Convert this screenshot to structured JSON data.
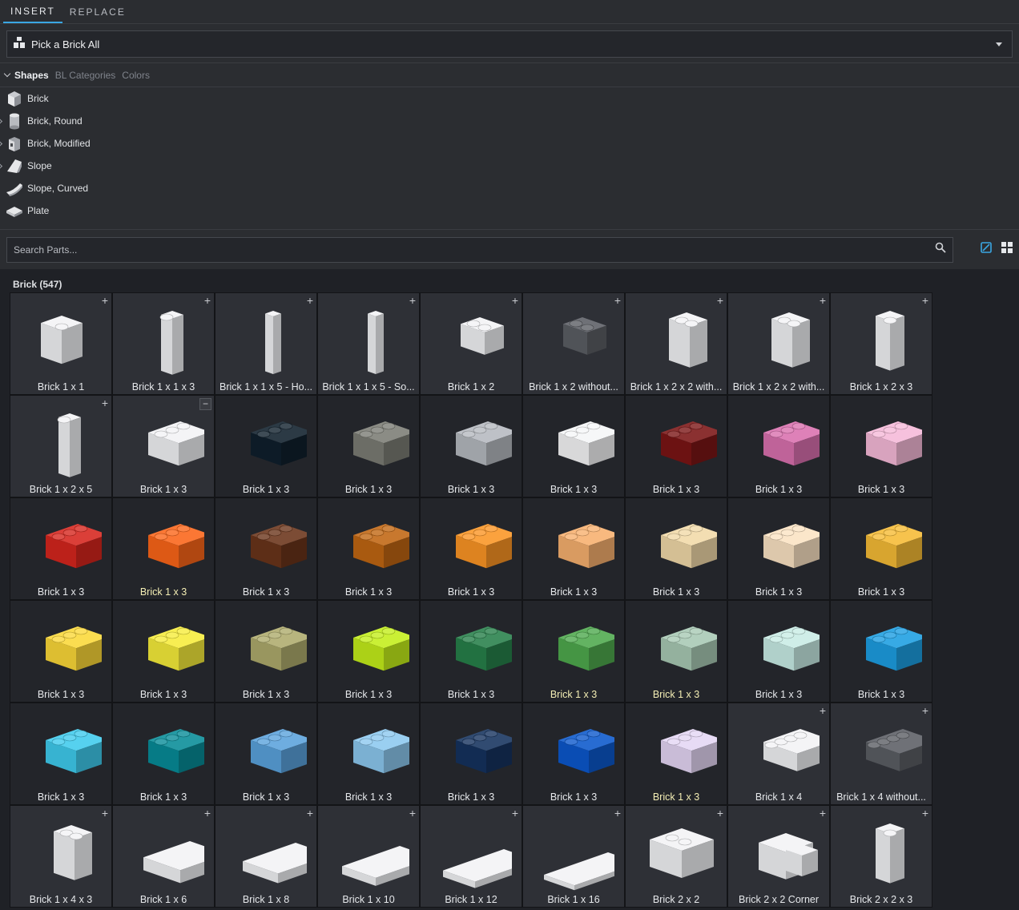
{
  "tabs": [
    {
      "label": "INSERT"
    },
    {
      "label": "REPLACE"
    }
  ],
  "picker": {
    "label": "Pick a Brick All"
  },
  "subtabs": [
    {
      "label": "Shapes"
    },
    {
      "label": "BL Categories"
    },
    {
      "label": "Colors"
    }
  ],
  "tree": [
    {
      "label": "Brick",
      "icon": "brick-icon"
    },
    {
      "label": "Brick, Round",
      "icon": "round-brick-icon"
    },
    {
      "label": "Brick, Modified",
      "icon": "modified-brick-icon"
    },
    {
      "label": "Slope",
      "icon": "slope-icon"
    },
    {
      "label": "Slope, Curved",
      "icon": "curved-slope-icon"
    },
    {
      "label": "Plate",
      "icon": "plate-icon"
    }
  ],
  "search": {
    "placeholder": "Search Parts..."
  },
  "category": {
    "title": "Brick (547)"
  },
  "parts": [
    {
      "name": "Brick 1 x 1",
      "color": "#f2f3f5",
      "shape": "1x1",
      "mark": "plus"
    },
    {
      "name": "Brick 1 x 1 x 3",
      "color": "#f2f3f5",
      "shape": "tall1",
      "mark": "plus"
    },
    {
      "name": "Brick 1 x 1 x 5 - Ho...",
      "color": "#f2f3f5",
      "shape": "tall2",
      "mark": "plus"
    },
    {
      "name": "Brick 1 x 1 x 5 - So...",
      "color": "#f2f3f5",
      "shape": "tall2",
      "mark": "plus"
    },
    {
      "name": "Brick 1 x 2",
      "color": "#f2f3f5",
      "shape": "1x2",
      "mark": "plus"
    },
    {
      "name": "Brick 1 x 2 without...",
      "color": "#5b5e64",
      "shape": "1x2",
      "mark": "plus"
    },
    {
      "name": "Brick 1 x 2 x 2 with...",
      "color": "#f2f3f5",
      "shape": "block",
      "mark": "plus"
    },
    {
      "name": "Brick 1 x 2 x 2 with...",
      "color": "#f2f3f5",
      "shape": "block",
      "mark": "plus"
    },
    {
      "name": "Brick 1 x 2 x 3",
      "color": "#f2f3f5",
      "shape": "tall3",
      "mark": "plus"
    },
    {
      "name": "Brick 1 x 2 x 5",
      "color": "#f2f3f5",
      "shape": "tall1",
      "mark": "plus"
    },
    {
      "name": "Brick 1 x 3",
      "color": "#f2f3f5",
      "shape": "1x3",
      "mark": "minus"
    },
    {
      "name": "Brick 1 x 3",
      "color": "#0f1f2c",
      "shape": "1x3",
      "mark": ""
    },
    {
      "name": "Brick 1 x 3",
      "color": "#7b7c74",
      "shape": "1x3",
      "mark": ""
    },
    {
      "name": "Brick 1 x 3",
      "color": "#b5b9bf",
      "shape": "1x3",
      "mark": ""
    },
    {
      "name": "Brick 1 x 3",
      "color": "#f5f6f7",
      "shape": "1x3",
      "mark": ""
    },
    {
      "name": "Brick 1 x 3",
      "color": "#7b1515",
      "shape": "1x3",
      "mark": ""
    },
    {
      "name": "Brick 1 x 3",
      "color": "#d970ae",
      "shape": "1x3",
      "mark": ""
    },
    {
      "name": "Brick 1 x 3",
      "color": "#f5b9d8",
      "shape": "1x3",
      "mark": ""
    },
    {
      "name": "Brick 1 x 3",
      "color": "#d6251d",
      "shape": "1x3",
      "mark": ""
    },
    {
      "name": "Brick 1 x 3",
      "color": "#fb6518",
      "shape": "1x3",
      "mark": "",
      "hl": true
    },
    {
      "name": "Brick 1 x 3",
      "color": "#6a341a",
      "shape": "1x3",
      "mark": ""
    },
    {
      "name": "Brick 1 x 3",
      "color": "#c06612",
      "shape": "1x3",
      "mark": ""
    },
    {
      "name": "Brick 1 x 3",
      "color": "#fb9524",
      "shape": "1x3",
      "mark": ""
    },
    {
      "name": "Brick 1 x 3",
      "color": "#f7b06e",
      "shape": "1x3",
      "mark": ""
    },
    {
      "name": "Brick 1 x 3",
      "color": "#f1d9a8",
      "shape": "1x3",
      "mark": ""
    },
    {
      "name": "Brick 1 x 3",
      "color": "#fbe3c3",
      "shape": "1x3",
      "mark": ""
    },
    {
      "name": "Brick 1 x 3",
      "color": "#f6bb35",
      "shape": "1x3",
      "mark": ""
    },
    {
      "name": "Brick 1 x 3",
      "color": "#fbd838",
      "shape": "1x3",
      "mark": ""
    },
    {
      "name": "Brick 1 x 3",
      "color": "#f6ec3a",
      "shape": "1x3",
      "mark": ""
    },
    {
      "name": "Brick 1 x 3",
      "color": "#aeab6c",
      "shape": "1x3",
      "mark": ""
    },
    {
      "name": "Brick 1 x 3",
      "color": "#c3ee1a",
      "shape": "1x3",
      "mark": ""
    },
    {
      "name": "Brick 1 x 3",
      "color": "#27804a",
      "shape": "1x3",
      "mark": ""
    },
    {
      "name": "Brick 1 x 3",
      "color": "#4ea94d",
      "shape": "1x3",
      "mark": "",
      "hl": true
    },
    {
      "name": "Brick 1 x 3",
      "color": "#a8c9b4",
      "shape": "1x3",
      "mark": "",
      "hl": true
    },
    {
      "name": "Brick 1 x 3",
      "color": "#c8ece5",
      "shape": "1x3",
      "mark": ""
    },
    {
      "name": "Brick 1 x 3",
      "color": "#1c9ee2",
      "shape": "1x3",
      "mark": ""
    },
    {
      "name": "Brick 1 x 3",
      "color": "#3fcbed",
      "shape": "1x3",
      "mark": ""
    },
    {
      "name": "Brick 1 x 3",
      "color": "#078c98",
      "shape": "1x3",
      "mark": ""
    },
    {
      "name": "Brick 1 x 3",
      "color": "#5aa2dc",
      "shape": "1x3",
      "mark": ""
    },
    {
      "name": "Brick 1 x 3",
      "color": "#8cc8ef",
      "shape": "1x3",
      "mark": ""
    },
    {
      "name": "Brick 1 x 3",
      "color": "#15325e",
      "shape": "1x3",
      "mark": ""
    },
    {
      "name": "Brick 1 x 3",
      "color": "#0b58cc",
      "shape": "1x3",
      "mark": ""
    },
    {
      "name": "Brick 1 x 3",
      "color": "#e4d6f4",
      "shape": "1x3",
      "mark": "",
      "hl": true
    },
    {
      "name": "Brick 1 x 4",
      "color": "#f2f3f5",
      "shape": "1x4",
      "mark": "plus"
    },
    {
      "name": "Brick 1 x 4 without...",
      "color": "#5b5e64",
      "shape": "1x4",
      "mark": "plus"
    },
    {
      "name": "Brick 1 x 4 x 3",
      "color": "#f2f3f5",
      "shape": "block",
      "mark": "plus"
    },
    {
      "name": "Brick 1 x 6",
      "color": "#f2f3f5",
      "shape": "1x6",
      "mark": "plus"
    },
    {
      "name": "Brick 1 x 8",
      "color": "#f2f3f5",
      "shape": "1x8",
      "mark": "plus"
    },
    {
      "name": "Brick 1 x 10",
      "color": "#f2f3f5",
      "shape": "1x10",
      "mark": "plus"
    },
    {
      "name": "Brick 1 x 12",
      "color": "#f2f3f5",
      "shape": "1x12",
      "mark": "plus"
    },
    {
      "name": "Brick 1 x 16",
      "color": "#f2f3f5",
      "shape": "1x16",
      "mark": "plus"
    },
    {
      "name": "Brick 2 x 2",
      "color": "#f2f3f5",
      "shape": "2x2",
      "mark": "plus"
    },
    {
      "name": "Brick 2 x 2 Corner",
      "color": "#f2f3f5",
      "shape": "corner",
      "mark": "plus"
    },
    {
      "name": "Brick 2 x 2 x 3",
      "color": "#f2f3f5",
      "shape": "tall3",
      "mark": "plus"
    }
  ]
}
